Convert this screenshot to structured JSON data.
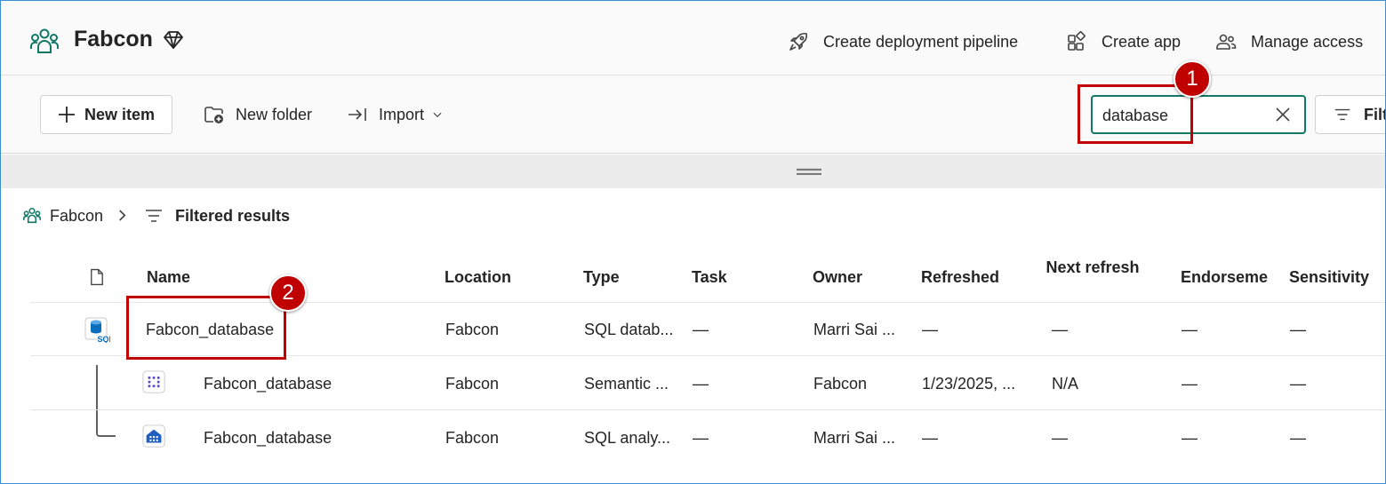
{
  "header": {
    "workspace_name": "Fabcon",
    "workspace_icon": "workspace-people-icon",
    "premium_icon": "diamond-icon",
    "actions": [
      {
        "label": "Create deployment pipeline",
        "icon": "rocket-icon"
      },
      {
        "label": "Create app",
        "icon": "app-grid-icon"
      },
      {
        "label": "Manage access",
        "icon": "people-icon"
      }
    ]
  },
  "toolbar": {
    "new_item_label": "New item",
    "new_folder_label": "New folder",
    "import_label": "Import",
    "search_value": "database",
    "filter_label": "Filter"
  },
  "breadcrumb": {
    "workspace": "Fabcon",
    "separator": ">",
    "current": "Filtered results"
  },
  "table": {
    "columns": [
      "Name",
      "Location",
      "Type",
      "Task",
      "Owner",
      "Refreshed",
      "Next refresh",
      "Endorseme",
      "Sensitivity"
    ],
    "rows": [
      {
        "name": "Fabcon_database",
        "location": "Fabcon",
        "type": "SQL datab...",
        "task": "—",
        "owner": "Marri Sai ...",
        "refreshed": "—",
        "next_refresh": "—",
        "endorsement": "—",
        "sensitivity": "—",
        "icon": "sql-database-icon"
      },
      {
        "name": "Fabcon_database",
        "location": "Fabcon",
        "type": "Semantic ...",
        "task": "—",
        "owner": "Fabcon",
        "refreshed": "1/23/2025, ...",
        "next_refresh": "N/A",
        "endorsement": "—",
        "sensitivity": "—",
        "icon": "semantic-model-icon"
      },
      {
        "name": "Fabcon_database",
        "location": "Fabcon",
        "type": "SQL analy...",
        "task": "—",
        "owner": "Marri Sai ...",
        "refreshed": "—",
        "next_refresh": "—",
        "endorsement": "—",
        "sensitivity": "—",
        "icon": "sql-analytics-endpoint-icon"
      }
    ],
    "sql_icon_text": "SQL"
  },
  "annotations": [
    {
      "number": "1",
      "target": "search box"
    },
    {
      "number": "2",
      "target": "Fabcon_database row"
    }
  ],
  "colors": {
    "accent": "#117865",
    "annotation": "#c00000",
    "frame_border": "#3c8fd4"
  }
}
